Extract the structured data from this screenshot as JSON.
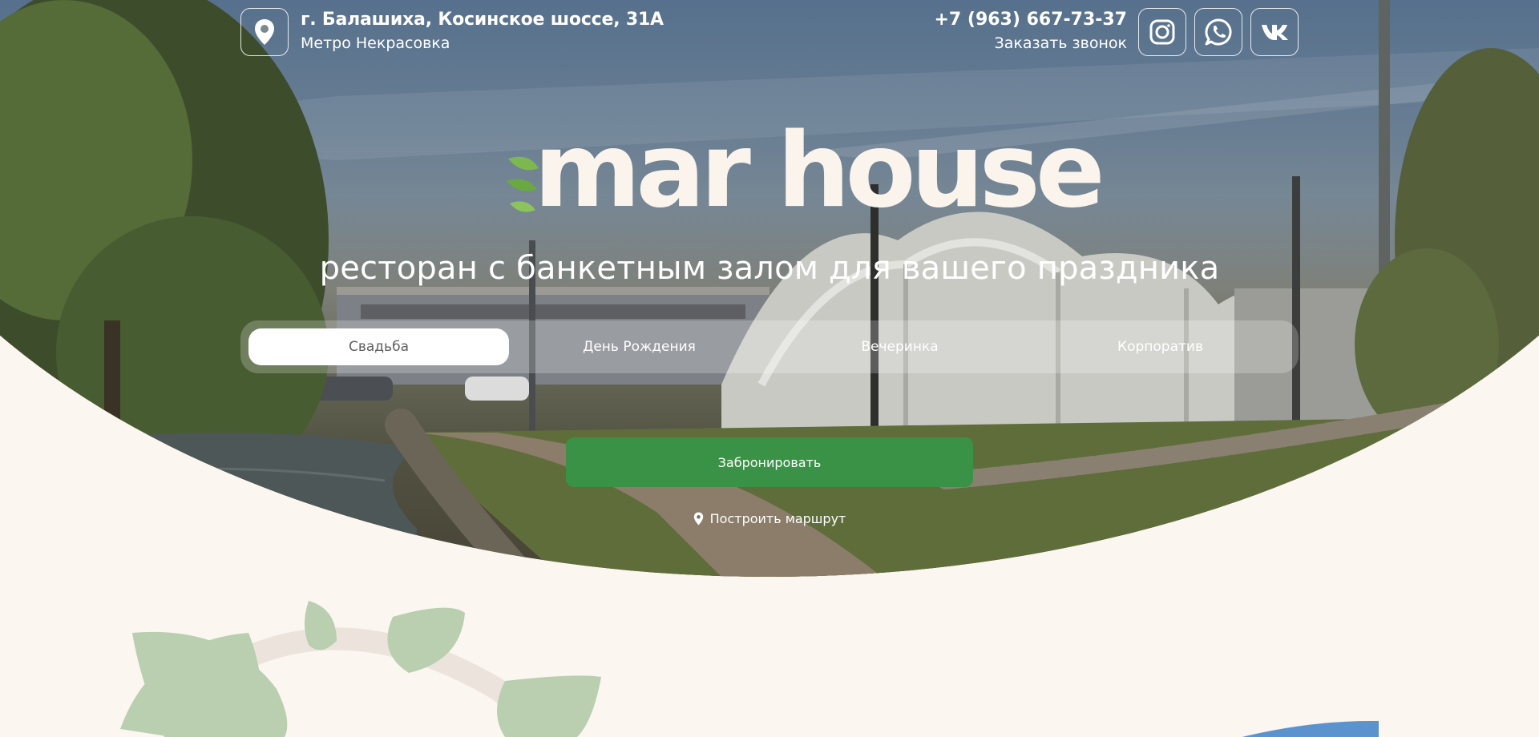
{
  "header": {
    "address": "г. Балашиха, Косинское шоссе, 31А",
    "metro": "Метро Некрасовка",
    "phone": "+7 (963) 667-73-37",
    "callback": "Заказать звонок",
    "icons": [
      "location-pin-icon",
      "instagram-icon",
      "whatsapp-icon",
      "vk-icon"
    ]
  },
  "brand": {
    "logo_text": "mar house",
    "leaf_color": "#7db84f",
    "tagline": "ресторан с банкетным залом для вашего праздника"
  },
  "tabs": [
    {
      "label": "Свадьба",
      "active": true
    },
    {
      "label": "День Рождения",
      "active": false
    },
    {
      "label": "Вечеринка",
      "active": false
    },
    {
      "label": "Корпоратив",
      "active": false
    }
  ],
  "cta": {
    "book_label": "Забронировать",
    "route_label": "Построить маршрут",
    "accent": "#3a9246"
  },
  "colors": {
    "page_bg": "#fbf6f0",
    "decor_leaves": "#b9cfb0",
    "decor_blue": "#5b93cf"
  }
}
